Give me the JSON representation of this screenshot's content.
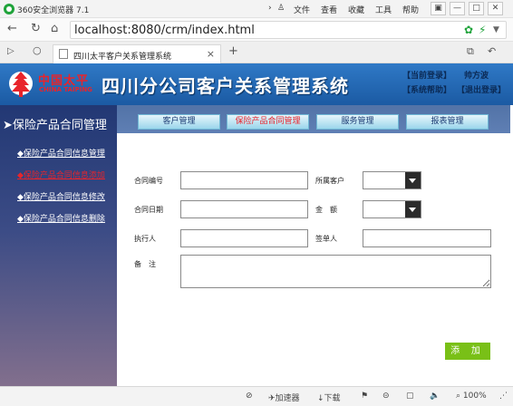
{
  "browser": {
    "title": "360安全浏览器 7.1",
    "menu": [
      "文件",
      "查看",
      "收藏",
      "工具",
      "帮助"
    ],
    "url": "localhost:8080/crm/index.html",
    "tab_title": "四川太平客户关系管理系统"
  },
  "header": {
    "brand_cn": "中国太平",
    "brand_en": "CHINA TAIPING",
    "system_title": "四川分公司客户关系管理系统",
    "links": {
      "current_login": "【当前登录】",
      "user_name": "帅方波",
      "help": "【系统帮助】",
      "logout": "【退出登录】"
    }
  },
  "sidebar": {
    "title": "保险产品合同管理",
    "items": [
      {
        "label": "保险产品合同信息管理"
      },
      {
        "label": "保险产品合同信息添加"
      },
      {
        "label": "保险产品合同信息修改"
      },
      {
        "label": "保险产品合同信息删除"
      }
    ]
  },
  "nav": {
    "tabs": [
      {
        "label": "客户管理"
      },
      {
        "label": "保险产品合同管理"
      },
      {
        "label": "服务管理"
      },
      {
        "label": "报表管理"
      }
    ]
  },
  "form": {
    "contract_no_label": "合同编号",
    "customer_label": "所属客户",
    "date_label": "合同日期",
    "amount_label": "金　额",
    "executor_label": "执行人",
    "signer_label": "签单人",
    "remark_label": "备　注",
    "submit_label": "添 加"
  },
  "statusbar": {
    "accelerator": "加速器",
    "download": "下载",
    "zoom": "100%"
  }
}
